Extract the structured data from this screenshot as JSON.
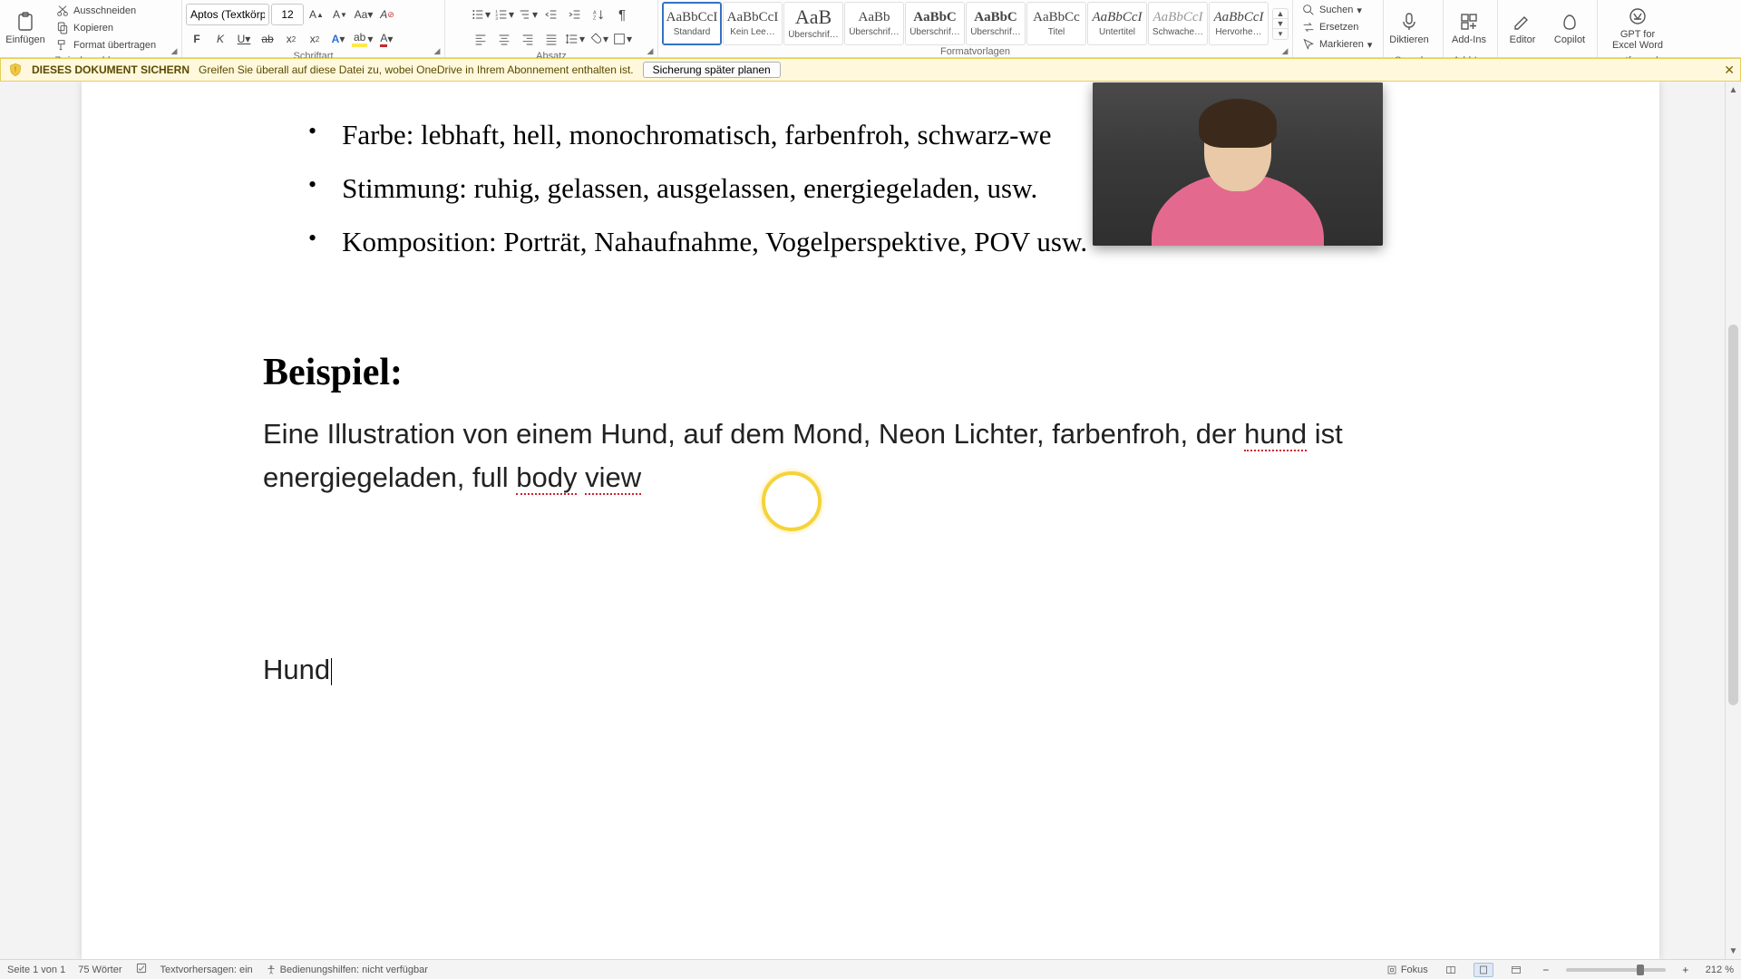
{
  "ribbon": {
    "clipboard": {
      "label": "Zwischenablage",
      "paste": "Einfügen",
      "cut": "Ausschneiden",
      "copy": "Kopieren",
      "format_painter": "Format übertragen"
    },
    "font": {
      "label": "Schriftart",
      "name": "Aptos (Textkörper)",
      "size": "12"
    },
    "paragraph": {
      "label": "Absatz"
    },
    "styles": {
      "label": "Formatvorlagen",
      "items": [
        {
          "preview": "AaBbCcI",
          "name": "Standard",
          "selected": true
        },
        {
          "preview": "AaBbCcI",
          "name": "Kein Lee…"
        },
        {
          "preview": "AaB",
          "name": "Überschrif…",
          "serif": true,
          "big": true
        },
        {
          "preview": "AaBb",
          "name": "Überschrif…",
          "serif": true
        },
        {
          "preview": "AaBbC",
          "name": "Überschrif…",
          "bold": true
        },
        {
          "preview": "AaBbC",
          "name": "Überschrif…",
          "bold": true
        },
        {
          "preview": "AaBbCc",
          "name": "Titel"
        },
        {
          "preview": "AaBbCcI",
          "name": "Untertitel",
          "italic": true
        },
        {
          "preview": "AaBbCcI",
          "name": "Schwache…",
          "italic": true,
          "faded": true
        },
        {
          "preview": "AaBbCcI",
          "name": "Hervorhe…",
          "italic": true
        }
      ]
    },
    "editing": {
      "find": "Suchen",
      "replace": "Ersetzen",
      "select": "Markieren"
    },
    "voice": {
      "label": "Sprache",
      "dictate": "Diktieren"
    },
    "addins": {
      "label": "Add-Ins",
      "btn": "Add-Ins"
    },
    "copilot": {
      "editor": "Editor",
      "copilot": "Copilot"
    },
    "gpt": {
      "label": "gptforwork",
      "btn": "GPT for\nExcel Word"
    }
  },
  "infobar": {
    "title": "DIESES DOKUMENT SICHERN",
    "message": "Greifen Sie überall auf diese Datei zu, wobei OneDrive in Ihrem Abonnement enthalten ist.",
    "button": "Sicherung später planen"
  },
  "document": {
    "bullets": [
      "Farbe: lebhaft, hell, monochromatisch, farbenfroh, schwarz-we",
      "Stimmung: ruhig, gelassen, ausgelassen, energiegeladen, usw.",
      "Komposition: Porträt, Nahaufnahme, Vogelperspektive, POV usw."
    ],
    "heading": "Beispiel:",
    "paragraph_pre": "Eine Illustration von einem Hund, auf dem Mond, Neon Lichter, farbenfroh, der ",
    "paragraph_flag1": "hund",
    "paragraph_mid": " ist energiegeladen, full ",
    "paragraph_flag2": "body",
    "paragraph_sp": " ",
    "paragraph_flag3": "view",
    "hund_line": "Hund"
  },
  "statusbar": {
    "page": "Seite 1 von 1",
    "words": "75 Wörter",
    "predictions": "Textvorhersagen: ein",
    "accessibility": "Bedienungshilfen: nicht verfügbar",
    "focus": "Fokus",
    "zoom": "212 %"
  }
}
